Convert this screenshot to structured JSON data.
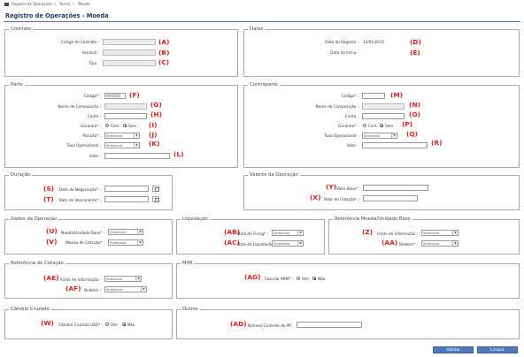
{
  "breadcrumb": {
    "items": [
      "Registro de Operações",
      "Termo",
      "Moeda"
    ]
  },
  "page_title": "Registro de Operações - Moeda",
  "contrato": {
    "legend": "Contrato",
    "codigo_label": "Código do Contrato :",
    "codigo_tag": "(A)",
    "variavel_label": "Variável :",
    "variavel_tag": "(B)",
    "tipo_label": "Tipo :",
    "tipo_tag": "(C)"
  },
  "datas": {
    "legend": "Datas",
    "registro_label": "Data do Registro :",
    "registro_value": "13/01/2015",
    "registro_tag": "(D)",
    "inicio_label": "Data do Início :",
    "inicio_tag": "(E)"
  },
  "parte": {
    "legend": "Parte",
    "codigo_label": "Código* :",
    "codigo_value": "900000",
    "codigo_tag": "(F)",
    "nome_label": "Nome do Composição :",
    "nome_tag": "(G)",
    "conta_label": "Conta :",
    "conta_tag": "(H)",
    "garantia_label": "Garantia* :",
    "garantia_com": "Com",
    "garantia_sem": "Sem",
    "garantia_tag": "(I)",
    "posicao_label": "Posição* :",
    "posicao_value": "Selecione",
    "posicao_tag": "(J)",
    "taxa_label": "Taxa Operacional :",
    "taxa_value": "Selecione",
    "taxa_tag": "(K)",
    "valor_label": "Valor :",
    "valor_tag": "(L)"
  },
  "contraparte": {
    "legend": "Contraparte",
    "codigo_label": "Código* :",
    "codigo_tag": "(M)",
    "nome_label": "Nome do Composição :",
    "nome_tag": "(N)",
    "conta_label": "Conta :",
    "conta_tag": "(O)",
    "garantia_label": "Garantia* :",
    "garantia_com": "Com",
    "garantia_sem": "Sem",
    "garantia_tag": "(P)",
    "taxa_label": "Taxa Operacional :",
    "taxa_value": "Selecione",
    "taxa_tag": "(Q)",
    "valor_label": "Valor :",
    "valor_tag": "(R)"
  },
  "duracao": {
    "legend": "Duração",
    "negociacao_label": "Data de Negociação* :",
    "negociacao_tag": "(S)",
    "vencimento_label": "Data de Vencimento* :",
    "vencimento_tag": "(T)"
  },
  "valores": {
    "legend": "Valores da Operação",
    "base_label": "Valor Base* :",
    "base_tag": "(Y)",
    "cotacao_label": "Valor de Cotação* :",
    "cotacao_tag": "(X)"
  },
  "dados": {
    "legend": "Dados da Operação",
    "moeda_label": "Moeda/Unidade Base* :",
    "moeda_value": "Selecione",
    "moeda_tag": "(U)",
    "cotacao_label": "Moeda de Cotação* :",
    "cotacao_value": "Selecione",
    "cotacao_tag": "(V)"
  },
  "liquidacao": {
    "legend": "Liquidação",
    "fixing_label": "Data de Fixing* :",
    "fixing_value": "Selecione",
    "fixing_tag": "(AB)",
    "liquidacao_label": "Data de Liquidação* :",
    "liquidacao_value": "Selecione",
    "liquidacao_tag": "(AC)"
  },
  "referencia_base": {
    "legend": "Referência Moeda/Unidade Base",
    "fonte_label": "Fonte de Informação :",
    "fonte_value": "Selecione",
    "fonte_tag": "(Z)",
    "boletim_label": "Boletim* :",
    "boletim_value": "Selecione",
    "boletim_tag": "(AA)"
  },
  "referencia_cotacao": {
    "legend": "Referência de Cotação",
    "fonte_label": "Fonte de Informação :",
    "fonte_value": "Selecione",
    "fonte_tag": "(AE)",
    "boletim_label": "Boletim :",
    "boletim_value": "Selecione",
    "boletim_tag": "(AF)"
  },
  "mtm": {
    "legend": "MtM",
    "calcular_label": "Calcular MtM* :",
    "sim": "Sim",
    "nao": "Não",
    "tag": "(AG)"
  },
  "cambio": {
    "legend": "Câmbio Cruzado",
    "cruzado_label": "Câmbio Cruzado USD* :",
    "sim": "Sim",
    "nao": "Não",
    "tag": "(W)"
  },
  "outros": {
    "legend": "Outros",
    "numero_label": "Número Controle do PR :",
    "tag": "(AD)"
  },
  "actions": {
    "validar": "Validar",
    "limpar": "Limpar"
  }
}
